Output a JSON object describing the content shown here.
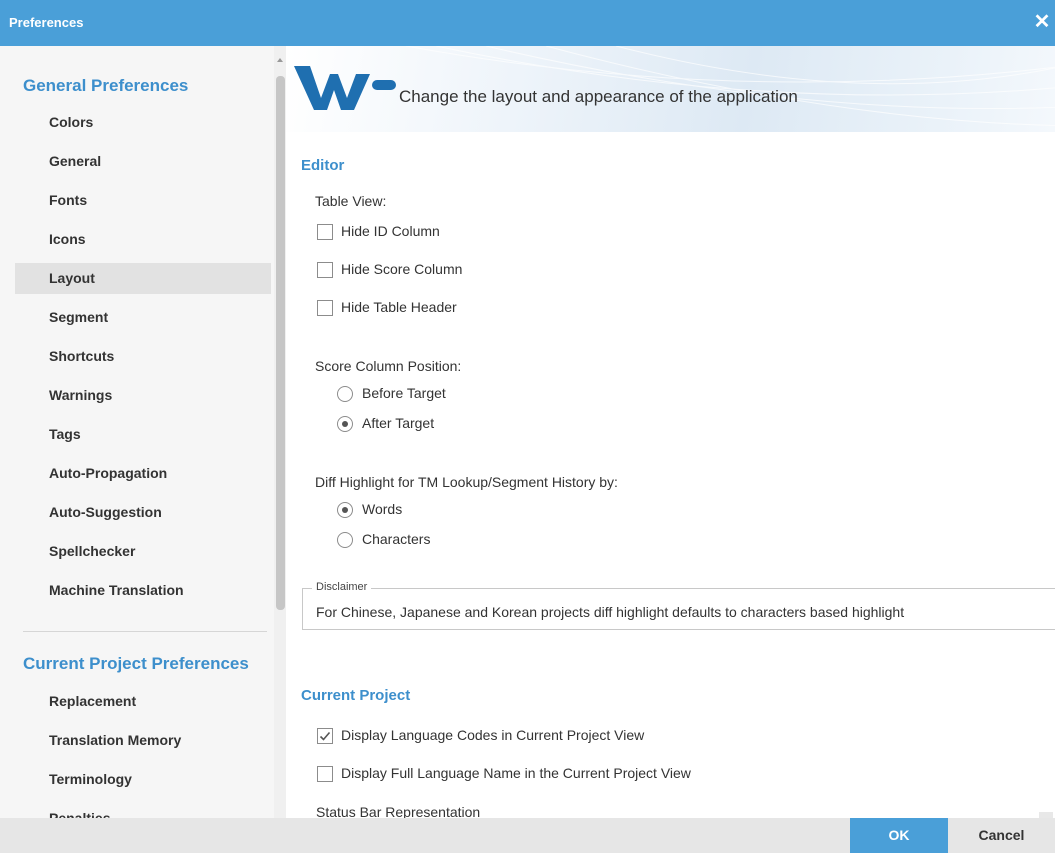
{
  "window": {
    "title": "Preferences",
    "close_icon": "close-icon"
  },
  "sidebar": {
    "general_heading": "General Preferences",
    "general_items": [
      {
        "label": "Colors"
      },
      {
        "label": "General"
      },
      {
        "label": "Fonts"
      },
      {
        "label": "Icons"
      },
      {
        "label": "Layout",
        "selected": true
      },
      {
        "label": "Segment"
      },
      {
        "label": "Shortcuts"
      },
      {
        "label": "Warnings"
      },
      {
        "label": "Tags"
      },
      {
        "label": "Auto-Propagation"
      },
      {
        "label": "Auto-Suggestion"
      },
      {
        "label": "Spellchecker"
      },
      {
        "label": "Machine Translation"
      }
    ],
    "project_heading": "Current Project Preferences",
    "project_items": [
      {
        "label": "Replacement"
      },
      {
        "label": "Translation Memory"
      },
      {
        "label": "Terminology"
      },
      {
        "label": "Penalties"
      }
    ]
  },
  "banner": {
    "description": "Change the layout and appearance of the application",
    "logo_icon": "wf-logo-icon"
  },
  "editor": {
    "title": "Editor",
    "table_view_label": "Table View:",
    "table_options": [
      {
        "label": "Hide ID Column",
        "checked": false
      },
      {
        "label": "Hide Score Column",
        "checked": false
      },
      {
        "label": "Hide Table Header",
        "checked": false
      }
    ],
    "score_position_label": "Score Column Position:",
    "score_position_options": [
      {
        "label": "Before Target",
        "selected": false
      },
      {
        "label": "After Target",
        "selected": true
      }
    ],
    "diff_label": "Diff Highlight for TM Lookup/Segment History by:",
    "diff_options": [
      {
        "label": "Words",
        "selected": true
      },
      {
        "label": "Characters",
        "selected": false
      }
    ],
    "disclaimer_legend": "Disclaimer",
    "disclaimer_text": "For Chinese, Japanese and Korean projects diff highlight defaults to characters based highlight"
  },
  "current_project": {
    "title": "Current Project",
    "options": [
      {
        "label": "Display Language Codes in Current Project View",
        "checked": true
      },
      {
        "label": "Display Full Language Name in the Current Project View",
        "checked": false
      }
    ],
    "partial_label": "Status Bar Representation"
  },
  "footer": {
    "ok_label": "OK",
    "cancel_label": "Cancel"
  },
  "colors": {
    "accent": "#4a9fd8",
    "heading": "#3d8fcc",
    "logo": "#1f6fb0"
  }
}
